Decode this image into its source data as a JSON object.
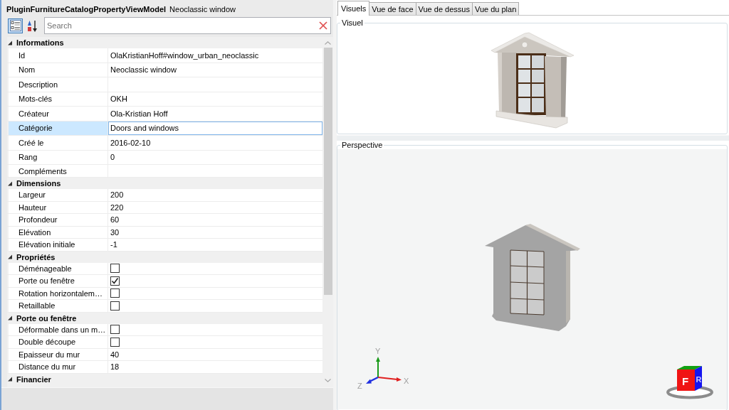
{
  "header": {
    "type_name": "PluginFurnitureCatalogPropertyViewModel",
    "object_name": "Neoclassic window"
  },
  "toolbar": {
    "view_modes": [
      {
        "kind": "categorized",
        "selected": true
      },
      {
        "kind": "alphabetical",
        "selected": false
      }
    ],
    "search": {
      "placeholder": "Search"
    }
  },
  "property_grid": {
    "categories": [
      {
        "name": "Informations",
        "expanded": true,
        "properties": [
          {
            "name": "Id",
            "kind": "text",
            "value": "OlaKristianHoff#window_urban_neoclassic",
            "selected": false
          },
          {
            "name": "Nom",
            "kind": "text",
            "value": "Neoclassic window",
            "selected": false
          },
          {
            "name": "Description",
            "kind": "text",
            "selected": false
          },
          {
            "name": "Mots-clés",
            "kind": "text",
            "value": "OKH",
            "selected": false
          },
          {
            "name": "Créateur",
            "kind": "text",
            "value": "Ola-Kristian Hoff",
            "selected": false
          },
          {
            "name": "Catégorie",
            "kind": "text",
            "value": "Doors and windows",
            "selected": true
          },
          {
            "name": "Créé le",
            "kind": "text",
            "value": "2016-02-10",
            "selected": false
          },
          {
            "name": "Rang",
            "kind": "text",
            "value": "0",
            "selected": false
          },
          {
            "name": "Compléments",
            "kind": "collection",
            "selected": false
          }
        ]
      },
      {
        "name": "Dimensions",
        "expanded": true,
        "properties": [
          {
            "name": "Largeur",
            "kind": "number",
            "value": "200",
            "selected": false
          },
          {
            "name": "Hauteur",
            "kind": "number",
            "value": "220",
            "selected": false
          },
          {
            "name": "Profondeur",
            "kind": "number",
            "value": "60",
            "selected": false
          },
          {
            "name": "Elévation",
            "kind": "number",
            "value": "30",
            "selected": false
          },
          {
            "name": "Elévation initiale",
            "kind": "number",
            "value": "-1",
            "selected": false
          }
        ]
      },
      {
        "name": "Propriétés",
        "expanded": true,
        "properties": [
          {
            "name": "Déménageable",
            "kind": "checkbox",
            "checked": false,
            "selected": false
          },
          {
            "name": "Porte ou fenêtre",
            "kind": "checkbox",
            "checked": true,
            "selected": false
          },
          {
            "name": "Rotation horizontalem…",
            "kind": "checkbox",
            "checked": false,
            "selected": false
          },
          {
            "name": "Retaillable",
            "kind": "checkbox",
            "checked": false,
            "selected": false
          }
        ]
      },
      {
        "name": "Porte ou fenêtre",
        "expanded": true,
        "properties": [
          {
            "name": "Déformable dans un m…",
            "kind": "checkbox",
            "checked": false,
            "selected": false
          },
          {
            "name": "Double découpe",
            "kind": "checkbox",
            "checked": false,
            "selected": false
          },
          {
            "name": "Epaisseur du mur",
            "kind": "number",
            "value": "40",
            "selected": false
          },
          {
            "name": "Distance du mur",
            "kind": "number",
            "value": "18",
            "selected": false
          }
        ]
      },
      {
        "name": "Financier",
        "expanded": true
      }
    ]
  },
  "tabs": [
    {
      "label": "Visuels",
      "selected": true
    },
    {
      "label": "Vue de face",
      "selected": false
    },
    {
      "label": "Vue de dessus",
      "selected": false
    },
    {
      "label": "Vue du plan",
      "selected": false
    }
  ],
  "visual_panel": {
    "title": "Visuel"
  },
  "perspective_panel": {
    "title": "Perspective",
    "axis_labels": {
      "x": "X",
      "y": "Y",
      "z": "Z"
    },
    "view_cube": {
      "front": "F",
      "right": "R"
    }
  }
}
